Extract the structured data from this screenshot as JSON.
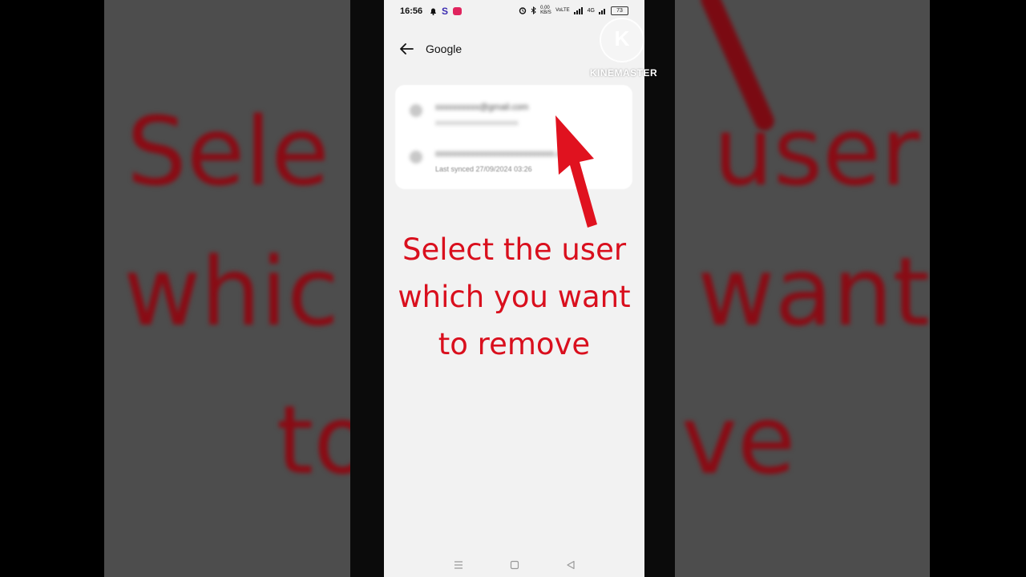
{
  "status_bar": {
    "time": "16:56",
    "left_icons": [
      "notification-icon",
      "s-app-icon",
      "video-app-icon"
    ],
    "network_speed": "0.00 KB/S",
    "network_type": "VoLTE",
    "signal_label": "4G",
    "battery": "73"
  },
  "header": {
    "title": "Google",
    "back_icon": "arrow-left-icon"
  },
  "accounts": [
    {
      "email": "xxxxxxxxxx@gmail.com",
      "subtitle": "xxxxxxxxxxxxxxxxxxxxxxx"
    },
    {
      "email": "xxxxxxxxxxxxxxxxxxxxxxxxxxx.com",
      "subtitle": "Last synced 27/09/2024 03:26"
    }
  ],
  "caption": {
    "line1": "Select the user",
    "line2": "which you want",
    "line3": "to remove"
  },
  "background_caption": {
    "line1_left": "Sele",
    "line1_right": "user",
    "line2_left": "whic",
    "line2_right": "want",
    "line3_left": "to",
    "line3_right": "ve"
  },
  "watermark": {
    "letter": "K",
    "text": "KINEMASTER"
  },
  "nav_bar": {
    "icons": [
      "menu-icon",
      "home-square-icon",
      "back-triangle-icon"
    ]
  },
  "colors": {
    "caption_red": "#d90f1d",
    "screen_bg": "#f2f2f2",
    "card_bg": "#ffffff"
  }
}
